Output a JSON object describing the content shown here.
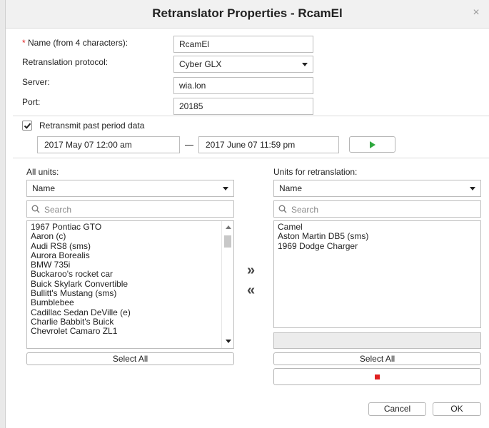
{
  "title": "Retranslator Properties - RcamEl",
  "close_glyph": "×",
  "form": {
    "name_required_mark": "*",
    "name_label": " Name (from 4 characters):",
    "name_value": "RcamEl",
    "protocol_label": "Retranslation protocol:",
    "protocol_value": "Cyber GLX",
    "server_label": "Server:",
    "server_value": "wia.lon",
    "port_label": "Port:",
    "port_value": "20185"
  },
  "retransmit": {
    "checked": true,
    "label": "Retransmit past period data",
    "date_from": "2017 May 07 12:00 am",
    "date_to": "2017 June 07 11:59 pm",
    "separator": "—"
  },
  "all_units": {
    "heading": "All units:",
    "filter_value": "Name",
    "search_placeholder": "Search",
    "items": [
      "1967 Pontiac GTO",
      "Aaron (c)",
      "Audi RS8 (sms)",
      "Aurora Borealis",
      "BMW 735i",
      "Buckaroo's rocket car",
      "Buick Skylark Convertible",
      "Bullitt's Mustang (sms)",
      "Bumblebee",
      "Cadillac Sedan DeVille (e)",
      "Charlie Babbit's Buick",
      "Chevrolet Camaro ZL1"
    ],
    "select_all_label": "Select All"
  },
  "transfer": {
    "add_glyph": "»",
    "remove_glyph": "«"
  },
  "retranslation_units": {
    "heading": "Units for retranslation:",
    "filter_value": "Name",
    "search_placeholder": "Search",
    "items": [
      "Camel",
      "Aston Martin DB5 (sms)",
      "1969 Dodge Charger"
    ],
    "select_all_label": "Select All"
  },
  "footer": {
    "cancel_label": "Cancel",
    "ok_label": "OK"
  },
  "colors": {
    "play_accent": "#2fa83f",
    "stop_accent": "#e02020",
    "required_mark": "#e02020"
  }
}
